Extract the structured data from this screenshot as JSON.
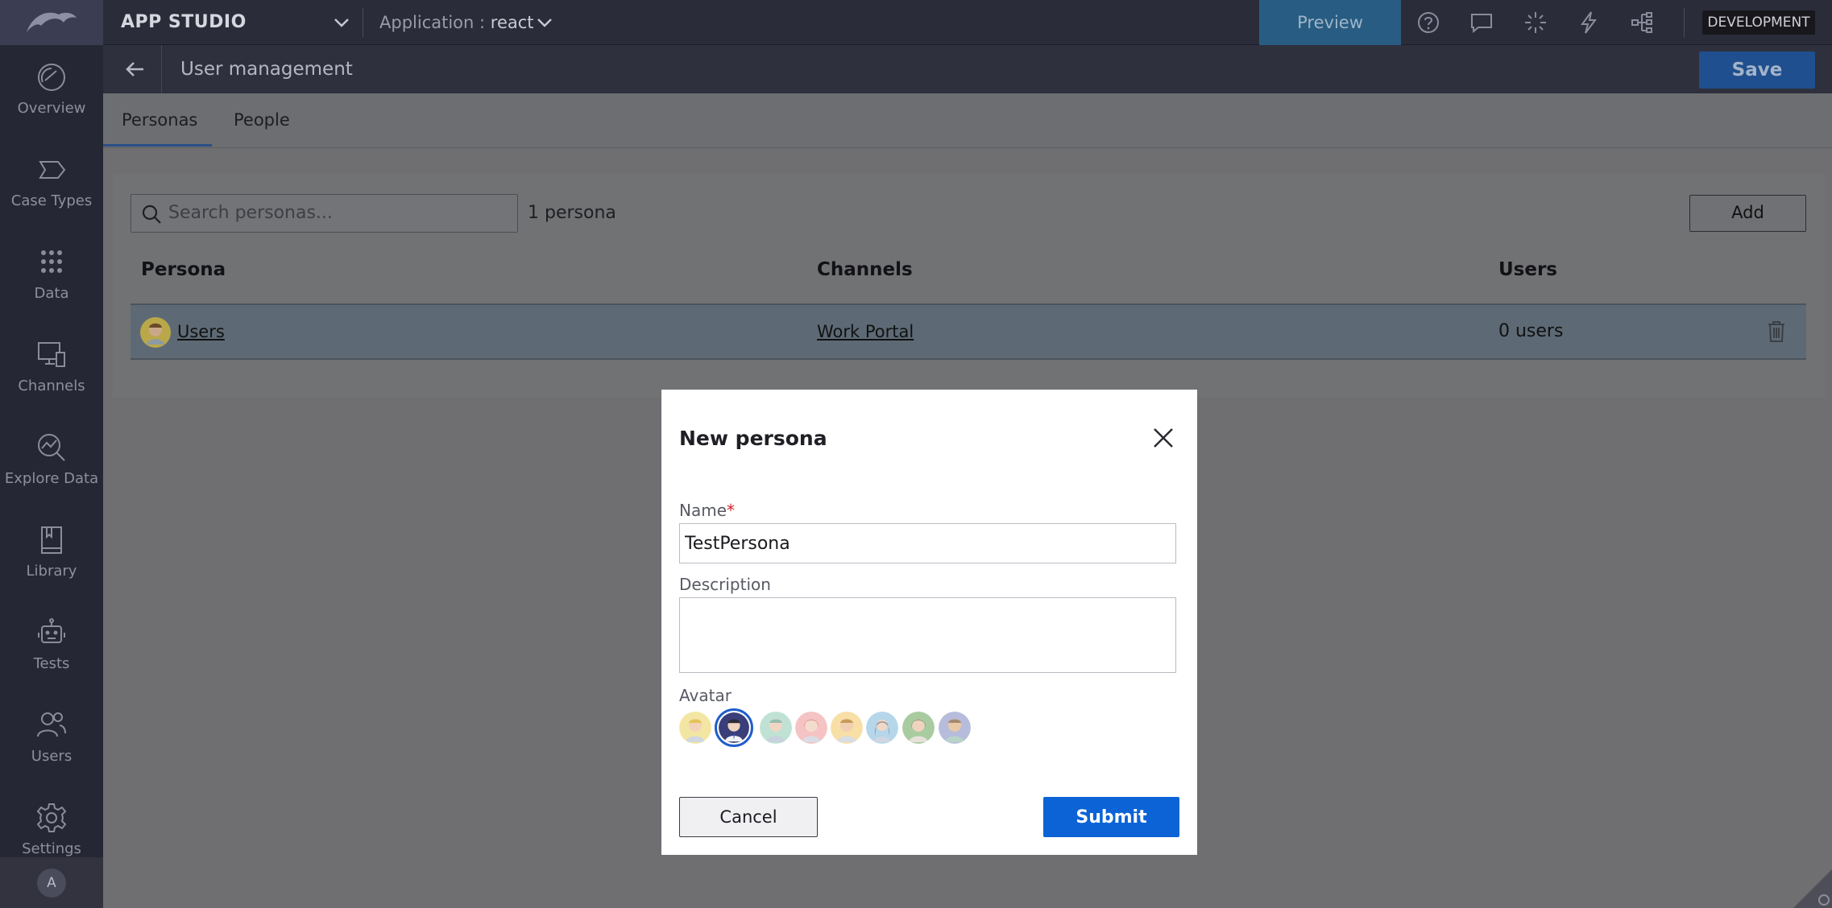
{
  "topbar": {
    "studio_name": "APP STUDIO",
    "application_label": "Application :",
    "application_name": "react",
    "preview_label": "Preview",
    "environment_badge": "DEVELOPMENT",
    "icons": [
      "help-icon",
      "comment-icon",
      "loading-icon",
      "lightning-icon",
      "hierarchy-icon"
    ]
  },
  "sidebar": {
    "items": [
      {
        "label": "Overview",
        "icon": "speedometer-icon"
      },
      {
        "label": "Case Types",
        "icon": "tag-outline-icon"
      },
      {
        "label": "Data",
        "icon": "dot-grid-icon"
      },
      {
        "label": "Channels",
        "icon": "devices-icon"
      },
      {
        "label": "Explore Data",
        "icon": "chart-search-icon"
      },
      {
        "label": "Library",
        "icon": "book-icon"
      },
      {
        "label": "Tests",
        "icon": "robot-icon"
      },
      {
        "label": "Users",
        "icon": "users-icon"
      },
      {
        "label": "Settings",
        "icon": "gear-icon"
      }
    ],
    "user_initial": "A"
  },
  "header": {
    "title": "User management",
    "save_label": "Save"
  },
  "tabs": [
    {
      "label": "Personas",
      "active": true
    },
    {
      "label": "People",
      "active": false
    }
  ],
  "personas": {
    "search_placeholder": "Search personas...",
    "count_text": "1 persona",
    "add_label": "Add",
    "columns": [
      "Persona",
      "Channels",
      "Users"
    ],
    "rows": [
      {
        "persona": "Users",
        "channel": "Work Portal",
        "users": "0 users"
      }
    ]
  },
  "modal": {
    "title": "New persona",
    "name_label": "Name",
    "required_mark": "*",
    "name_value": "TestPersona",
    "description_label": "Description",
    "description_value": "",
    "avatar_label": "Avatar",
    "avatar_count": 8,
    "selected_avatar_index": 1,
    "cancel_label": "Cancel",
    "submit_label": "Submit"
  },
  "colors": {
    "primary": "#0b63d6",
    "required": "#d4202a",
    "topbar": "#2b2c3a"
  }
}
